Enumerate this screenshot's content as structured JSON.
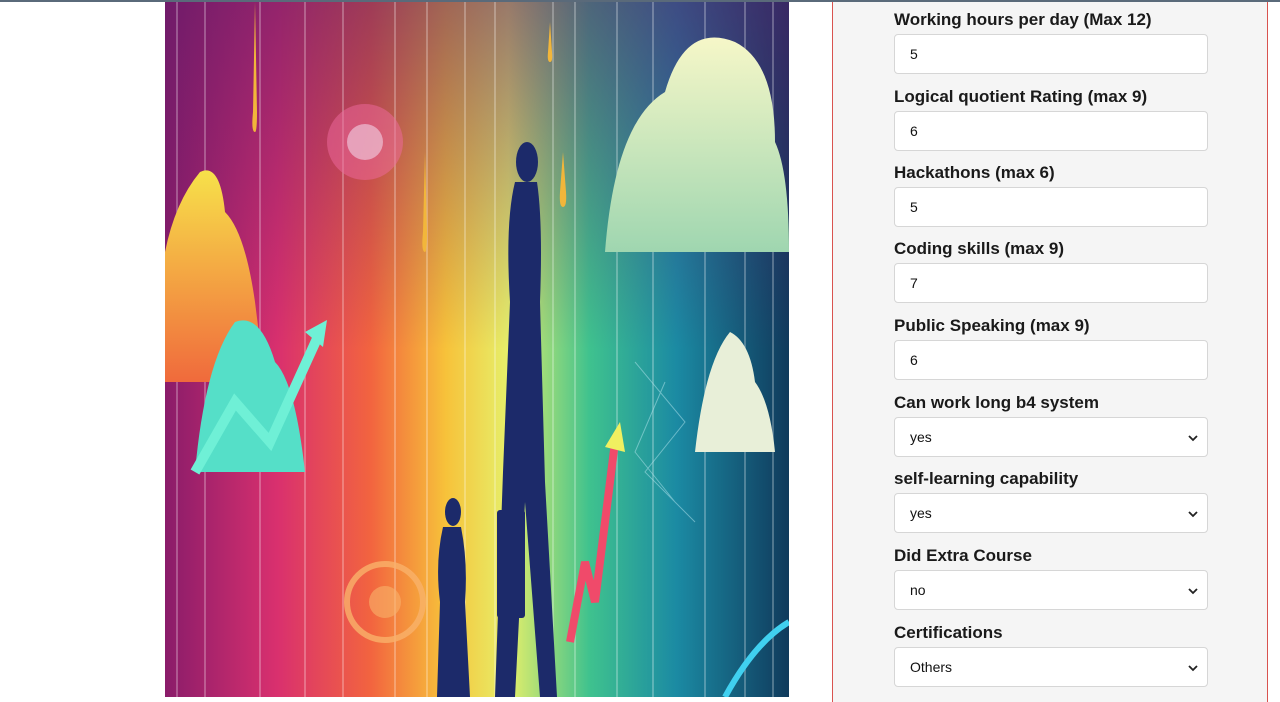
{
  "form": {
    "fields": [
      {
        "label": "Working hours per day (Max 12)",
        "value": "5",
        "kind": "input"
      },
      {
        "label": "Logical quotient Rating (max 9)",
        "value": "6",
        "kind": "input"
      },
      {
        "label": "Hackathons (max 6)",
        "value": "5",
        "kind": "input"
      },
      {
        "label": "Coding skills (max 9)",
        "value": "7",
        "kind": "input"
      },
      {
        "label": "Public Speaking (max 9)",
        "value": "6",
        "kind": "input"
      },
      {
        "label": "Can work long b4 system",
        "value": "yes",
        "kind": "select"
      },
      {
        "label": "self-learning capability",
        "value": "yes",
        "kind": "select"
      },
      {
        "label": "Did Extra Course",
        "value": "no",
        "kind": "select"
      },
      {
        "label": "Certifications",
        "value": "Others",
        "kind": "select"
      }
    ]
  },
  "colors": {
    "panel_border": "#d9534f",
    "panel_bg": "#f5f5f5"
  },
  "icons": {
    "select_arrow": "chevron-down-icon"
  }
}
